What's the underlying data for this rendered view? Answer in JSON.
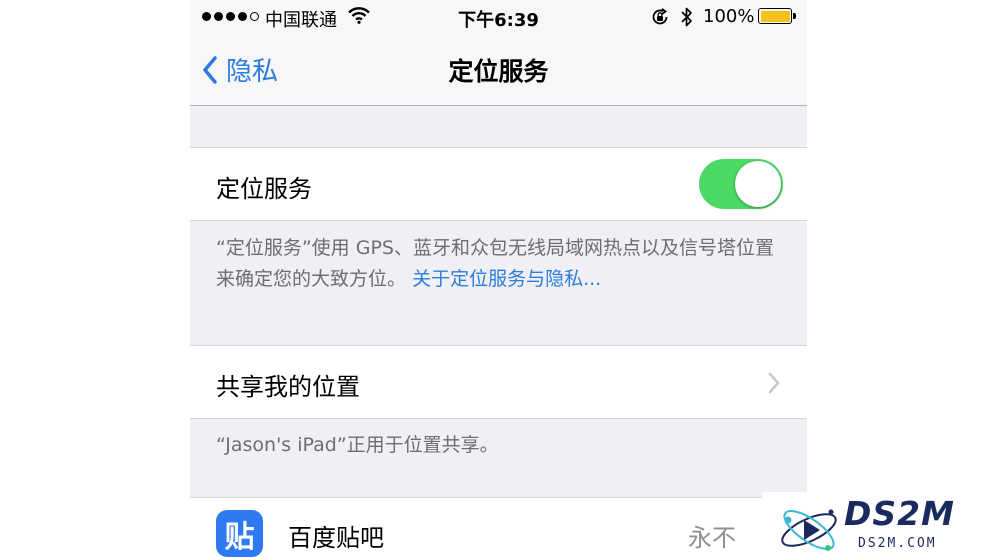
{
  "status_bar": {
    "carrier": "中国联通",
    "time": "下午6:39",
    "battery_percent": "100%",
    "signal_bars_filled": 4,
    "signal_bars_total": 5
  },
  "nav": {
    "back_label": "隐私",
    "title": "定位服务"
  },
  "location_services": {
    "label": "定位服务",
    "enabled": true,
    "footer_text": "“定位服务”使用 GPS、蓝牙和众包无线局域网热点以及信号塔位置来确定您的大致方位。",
    "footer_link": "关于定位服务与隐私..."
  },
  "share_location": {
    "label": "共享我的位置",
    "footer_text": "“Jason's iPad”正用于位置共享。"
  },
  "apps": [
    {
      "icon_glyph": "贴",
      "name": "百度贴吧",
      "value": "永不",
      "icon_color": "#2f7af2"
    }
  ],
  "colors": {
    "accent": "#2b7cde",
    "switch_on": "#4cd964",
    "battery": "#f5c21b",
    "group_background": "#efeff4"
  },
  "watermark": {
    "brand": "DS2M",
    "domain": "DS2M.COM"
  }
}
